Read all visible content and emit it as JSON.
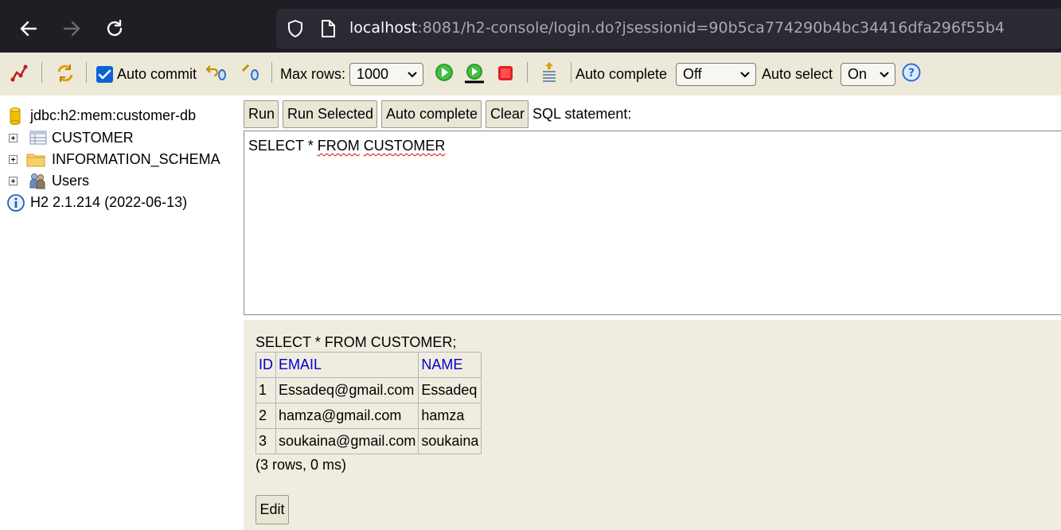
{
  "browser": {
    "url_host": "localhost",
    "url_rest": ":8081/h2-console/login.do?jsessionid=90b5ca774290b4bc34416dfa296f55b4"
  },
  "toolbar": {
    "auto_commit_label": "Auto commit",
    "auto_commit_checked": true,
    "max_rows_label": "Max rows:",
    "max_rows_value": "1000",
    "auto_complete_label": "Auto complete",
    "auto_complete_value": "Off",
    "auto_select_label": "Auto select",
    "auto_select_value": "On"
  },
  "tree": {
    "connection": "jdbc:h2:mem:customer-db",
    "items": [
      {
        "label": "CUSTOMER",
        "icon": "table-icon"
      },
      {
        "label": "INFORMATION_SCHEMA",
        "icon": "folder-icon"
      },
      {
        "label": "Users",
        "icon": "users-icon"
      }
    ],
    "version": "H2 2.1.214 (2022-06-13)"
  },
  "query": {
    "buttons": {
      "run": "Run",
      "run_selected": "Run Selected",
      "auto_complete": "Auto complete",
      "clear": "Clear"
    },
    "sql_label": "SQL statement:",
    "sql_text_part1": "SELECT * ",
    "sql_text_from": "FROM",
    "sql_text_space": " ",
    "sql_text_table": "CUSTOMER"
  },
  "result": {
    "statement": "SELECT * FROM CUSTOMER;",
    "columns": [
      "ID",
      "EMAIL",
      "NAME"
    ],
    "rows": [
      [
        "1",
        "Essadeq@gmail.com",
        "Essadeq"
      ],
      [
        "2",
        "hamza@gmail.com",
        "hamza"
      ],
      [
        "3",
        "soukaina@gmail.com",
        "soukaina"
      ]
    ],
    "row_count": "(3 rows, 0 ms)",
    "edit_label": "Edit"
  }
}
